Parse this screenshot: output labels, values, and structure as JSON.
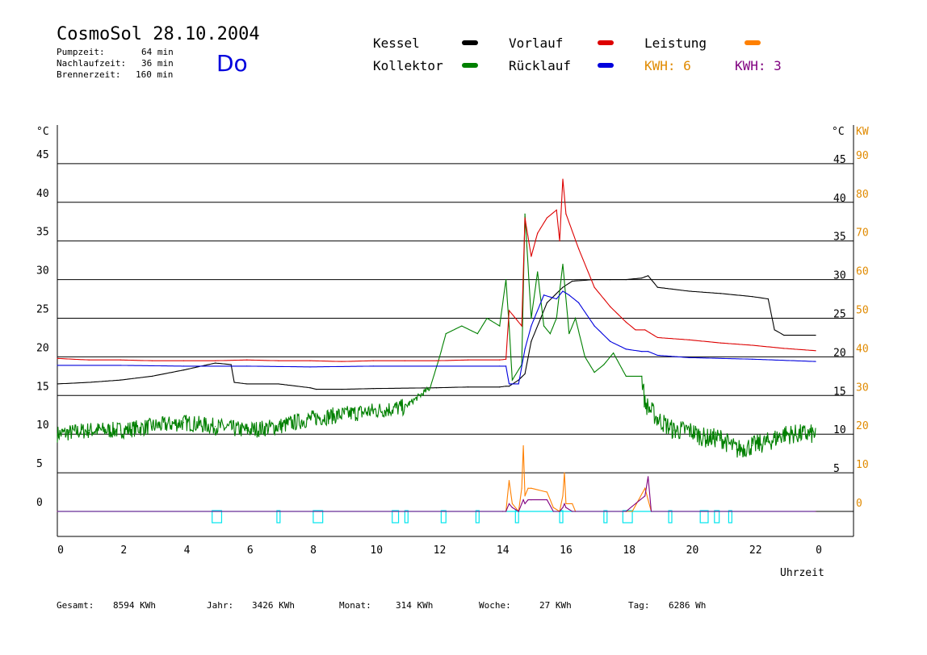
{
  "header": {
    "title": "CosmoSol 28.10.2004",
    "day": "Do",
    "stats": [
      {
        "label": "Pumpzeit:",
        "value": "64 min"
      },
      {
        "label": "Nachlaufzeit:",
        "value": "36 min"
      },
      {
        "label": "Brennerzeit:",
        "value": "160 min"
      }
    ]
  },
  "legend": {
    "kessel": "Kessel",
    "kollektor": "Kollektor",
    "vorlauf": "Vorlauf",
    "ruecklauf": "Rücklauf",
    "leistung": "Leistung",
    "kwh1": "KWH: 6",
    "kwh2": "KWH: 3"
  },
  "colors": {
    "kessel": "#000000",
    "kollektor": "#008000",
    "vorlauf": "#dd0000",
    "ruecklauf": "#0000dd",
    "leistung": "#ff8000",
    "kwh1": "#ff8000",
    "kwh2": "#800080",
    "pump": "#00e5ee"
  },
  "footer": [
    {
      "label": "Gesamt:",
      "value": "8594 KWh"
    },
    {
      "label": "Jahr:",
      "value": "3426 KWh"
    },
    {
      "label": "Monat:",
      "value": "314 KWh"
    },
    {
      "label": "Woche:",
      "value": "27 KWh"
    },
    {
      "label": "Tag:",
      "value": "6286 Wh"
    }
  ],
  "chart_data": {
    "type": "line",
    "xlabel": "Uhrzeit",
    "ylabel_left": "°C",
    "ylabel_right": "°C",
    "ylabel_right2": "KW",
    "xlim": [
      0,
      24
    ],
    "ylim": [
      0,
      50
    ],
    "ylim_kw": [
      0,
      100
    ],
    "grid": true,
    "legend_position": "top",
    "x_ticks": [
      "0",
      "2",
      "4",
      "6",
      "8",
      "10",
      "12",
      "14",
      "16",
      "18",
      "20",
      "22",
      "0"
    ],
    "y_ticks": [
      "0",
      "5",
      "10",
      "15",
      "20",
      "25",
      "30",
      "35",
      "40",
      "45"
    ],
    "y_ticks_right": [
      "5",
      "10",
      "15",
      "20",
      "25",
      "30",
      "35",
      "40",
      "45"
    ],
    "y_ticks_kw": [
      "0",
      "10",
      "20",
      "30",
      "40",
      "50",
      "60",
      "70",
      "80",
      "90"
    ],
    "series": [
      {
        "name": "Kessel",
        "key": "kessel",
        "x": [
          0,
          1,
          2,
          3,
          4,
          5,
          5.5,
          5.6,
          6,
          7,
          8,
          8.2,
          9,
          10,
          12,
          13,
          14,
          14.2,
          14.3,
          14.6,
          14.8,
          15,
          15.5,
          16,
          16.3,
          17,
          17.5,
          18,
          18.5,
          18.7,
          19,
          20,
          21,
          22,
          22.5,
          22.7,
          23,
          24
        ],
        "y": [
          16.5,
          16.7,
          17,
          17.5,
          18.3,
          19.2,
          19,
          16.7,
          16.5,
          16.5,
          16,
          15.8,
          15.8,
          15.9,
          16,
          16.1,
          16.1,
          16.2,
          16.2,
          17,
          17.8,
          22,
          27,
          29,
          29.8,
          30,
          30,
          30,
          30.2,
          30.5,
          29,
          28.5,
          28.2,
          27.8,
          27.5,
          23.5,
          22.8,
          22.8
        ]
      },
      {
        "name": "Kollektor",
        "key": "kollektor",
        "x": [
          0,
          1,
          2,
          3,
          4,
          5,
          6,
          7,
          8,
          9,
          10,
          11,
          11.8,
          12.1,
          12.3,
          12.8,
          13.3,
          13.6,
          14,
          14.2,
          14.3,
          14.4,
          14.7,
          14.8,
          15,
          15.2,
          15.4,
          15.6,
          15.8,
          16,
          16.2,
          16.4,
          16.7,
          17,
          17.3,
          17.6,
          18,
          18.5,
          18.6,
          19,
          19.5,
          20,
          20.5,
          21,
          21.5,
          22,
          22.5,
          23,
          24
        ],
        "y": [
          10,
          10.5,
          10.5,
          11,
          11.5,
          11,
          10.5,
          11,
          12,
          12.5,
          13,
          13.5,
          16,
          20,
          23,
          24,
          23,
          25,
          24,
          30,
          24,
          17,
          19,
          38.5,
          25,
          31,
          24,
          23,
          25,
          32,
          23,
          25,
          20,
          18,
          19,
          20.5,
          17.5,
          17.5,
          14,
          12,
          10.5,
          10.5,
          9.5,
          9.5,
          8,
          8.5,
          9,
          10,
          10
        ]
      },
      {
        "name": "Vorlauf",
        "key": "vorlauf",
        "x": [
          0,
          1,
          2,
          3,
          4,
          5,
          6,
          7,
          8,
          9,
          10,
          11,
          12,
          13,
          14,
          14.2,
          14.3,
          14.5,
          14.7,
          14.8,
          15,
          15.2,
          15.5,
          15.8,
          15.9,
          16,
          16.1,
          16.5,
          17,
          17.5,
          18,
          18.3,
          18.6,
          19,
          20,
          21,
          22,
          23,
          24
        ],
        "y": [
          19.8,
          19.6,
          19.6,
          19.5,
          19.5,
          19.5,
          19.6,
          19.5,
          19.5,
          19.4,
          19.5,
          19.5,
          19.5,
          19.6,
          19.6,
          19.7,
          26,
          25,
          24,
          38,
          33,
          36,
          38,
          39,
          35,
          43,
          38.5,
          34,
          29,
          26.5,
          24.5,
          23.5,
          23.5,
          22.5,
          22.2,
          21.8,
          21.5,
          21.1,
          20.8
        ]
      },
      {
        "name": "Rücklauf",
        "key": "ruecklauf",
        "x": [
          0,
          2,
          4,
          6,
          8,
          10,
          12,
          14,
          14.2,
          14.3,
          14.6,
          14.8,
          15,
          15.4,
          15.8,
          16,
          16.2,
          16.5,
          17,
          17.5,
          18,
          18.5,
          18.7,
          19,
          20,
          22,
          24
        ],
        "y": [
          18.9,
          18.9,
          18.8,
          18.8,
          18.7,
          18.8,
          18.8,
          18.8,
          18.8,
          16.5,
          16.5,
          21,
          24,
          28,
          27.5,
          28.5,
          28,
          27,
          24,
          22,
          21,
          20.7,
          20.7,
          20.2,
          19.9,
          19.7,
          19.4
        ]
      },
      {
        "name": "Leistung",
        "key": "leistung",
        "scale": "kw",
        "x": [
          0,
          14.1,
          14.2,
          14.3,
          14.4,
          14.6,
          14.7,
          14.75,
          14.8,
          14.9,
          15,
          15.5,
          15.7,
          15.9,
          16,
          16.05,
          16.1,
          16.3,
          16.4,
          18,
          18.2,
          18.6,
          18.8,
          24
        ],
        "y": [
          0,
          0,
          0,
          8,
          2,
          0,
          6,
          17,
          4,
          6,
          6,
          5,
          1,
          0,
          4,
          10,
          2,
          2,
          0,
          0,
          0,
          6,
          0,
          0
        ]
      },
      {
        "name": "KWH",
        "key": "kwh2",
        "scale": "kw",
        "x": [
          0,
          14.1,
          14.2,
          14.3,
          14.4,
          14.6,
          14.7,
          14.75,
          14.8,
          14.9,
          15,
          15.5,
          15.7,
          15.9,
          16,
          16.05,
          16.1,
          16.3,
          16.4,
          18,
          18.6,
          18.7,
          18.8,
          24
        ],
        "y": [
          0,
          0,
          0,
          2,
          1,
          0,
          2,
          3,
          2,
          3,
          3,
          3,
          0,
          0,
          1,
          2,
          1,
          0,
          0,
          0,
          4,
          9,
          0,
          0
        ]
      }
    ],
    "pump_events": [
      {
        "start": 4.9,
        "end": 5.2
      },
      {
        "start": 6.95,
        "end": 7.05
      },
      {
        "start": 8.1,
        "end": 8.4
      },
      {
        "start": 10.6,
        "end": 10.8
      },
      {
        "start": 11.0,
        "end": 11.1
      },
      {
        "start": 12.15,
        "end": 12.3
      },
      {
        "start": 13.25,
        "end": 13.35
      },
      {
        "start": 14.5,
        "end": 14.6
      },
      {
        "start": 15.9,
        "end": 16.0
      },
      {
        "start": 17.3,
        "end": 17.4
      },
      {
        "start": 17.9,
        "end": 18.2
      },
      {
        "start": 19.35,
        "end": 19.45
      },
      {
        "start": 20.35,
        "end": 20.6
      },
      {
        "start": 20.8,
        "end": 20.95
      },
      {
        "start": 21.25,
        "end": 21.35
      }
    ]
  }
}
